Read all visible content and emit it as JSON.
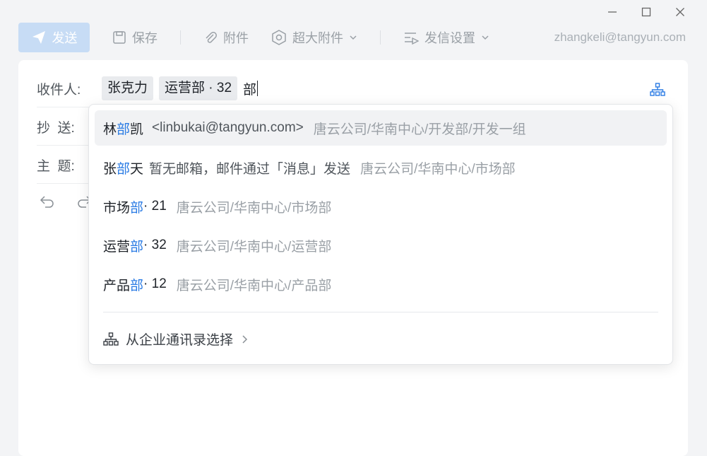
{
  "toolbar": {
    "send_label": "发送",
    "save_label": "保存",
    "attach_label": "附件",
    "big_attach_label": "超大附件",
    "send_settings_label": "发信设置",
    "account": "zhangkeli@tangyun.com"
  },
  "compose": {
    "to_label": "收件人:",
    "cc_label": "抄  送:",
    "subject_label": "主  题:",
    "recipients": [
      "张克力",
      "运营部 · 32"
    ],
    "typed_text": "部"
  },
  "suggestions": [
    {
      "pre": "林",
      "hl": "部",
      "post": "凯",
      "extra": "<linbukai@tangyun.com>",
      "path": "唐云公司/华南中心/开发部/开发一组"
    },
    {
      "pre": "张",
      "hl": "部",
      "post": "天",
      "extra": "暂无邮箱，邮件通过「消息」发送",
      "path": "唐云公司/华南中心/市场部"
    },
    {
      "pre": "市场",
      "hl": "部",
      "post": " · 21",
      "extra": "",
      "path": "唐云公司/华南中心/市场部"
    },
    {
      "pre": "运营",
      "hl": "部",
      "post": " · 32",
      "extra": "",
      "path": "唐云公司/华南中心/运营部"
    },
    {
      "pre": "产品",
      "hl": "部",
      "post": " · 12",
      "extra": "",
      "path": "唐云公司/华南中心/产品部"
    }
  ],
  "dropdown_footer": "从企业通讯录选择",
  "colors": {
    "accent": "#2a7be4",
    "send_disabled": "#c7dcf5",
    "highlight": "#f1f2f4"
  }
}
